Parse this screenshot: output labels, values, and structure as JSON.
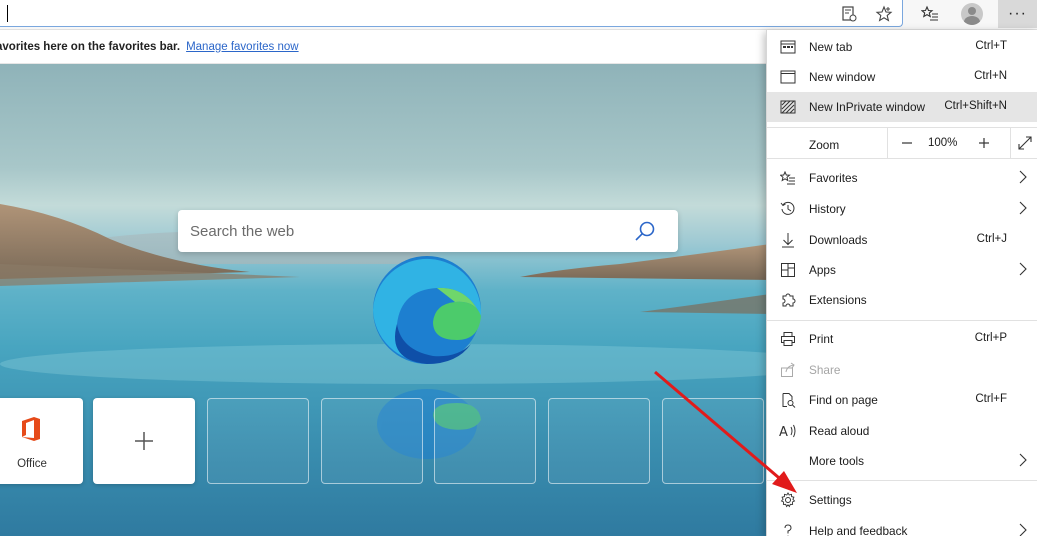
{
  "address_bar": {
    "value": ""
  },
  "toolbar": {
    "more_label": "···"
  },
  "favorites_bar": {
    "message": "avorites here on the favorites bar.",
    "manage_link": "Manage favorites now"
  },
  "ntp": {
    "search_placeholder": "Search the web",
    "tiles": [
      {
        "label": "Office",
        "type": "site"
      },
      {
        "label": "",
        "type": "add"
      }
    ]
  },
  "menu": {
    "items": [
      {
        "label": "New tab",
        "shortcut": "Ctrl+T",
        "icon": "new-tab-icon"
      },
      {
        "label": "New window",
        "shortcut": "Ctrl+N",
        "icon": "new-window-icon"
      },
      {
        "label": "New InPrivate window",
        "shortcut": "Ctrl+Shift+N",
        "icon": "inprivate-icon"
      },
      {
        "label": "Favorites",
        "shortcut": "",
        "icon": "favorites-icon"
      },
      {
        "label": "History",
        "shortcut": "",
        "icon": "history-icon"
      },
      {
        "label": "Downloads",
        "shortcut": "Ctrl+J",
        "icon": "download-icon"
      },
      {
        "label": "Apps",
        "shortcut": "",
        "icon": "apps-icon"
      },
      {
        "label": "Extensions",
        "shortcut": "",
        "icon": "extensions-icon"
      },
      {
        "label": "Print",
        "shortcut": "Ctrl+P",
        "icon": "print-icon"
      },
      {
        "label": "Share",
        "shortcut": "",
        "icon": "share-icon"
      },
      {
        "label": "Find on page",
        "shortcut": "Ctrl+F",
        "icon": "find-icon"
      },
      {
        "label": "Read aloud",
        "shortcut": "",
        "icon": "read-aloud-icon"
      },
      {
        "label": "More tools",
        "shortcut": "",
        "icon": ""
      },
      {
        "label": "Settings",
        "shortcut": "",
        "icon": "gear-icon"
      },
      {
        "label": "Help and feedback",
        "shortcut": "",
        "icon": "help-icon"
      }
    ],
    "zoom": {
      "label": "Zoom",
      "minus": "—",
      "value": "100%",
      "plus": "+"
    }
  },
  "colors": {
    "accent": "#2b66c9",
    "arrow": "#e11b1b",
    "highlight": "#e5e5e5"
  }
}
